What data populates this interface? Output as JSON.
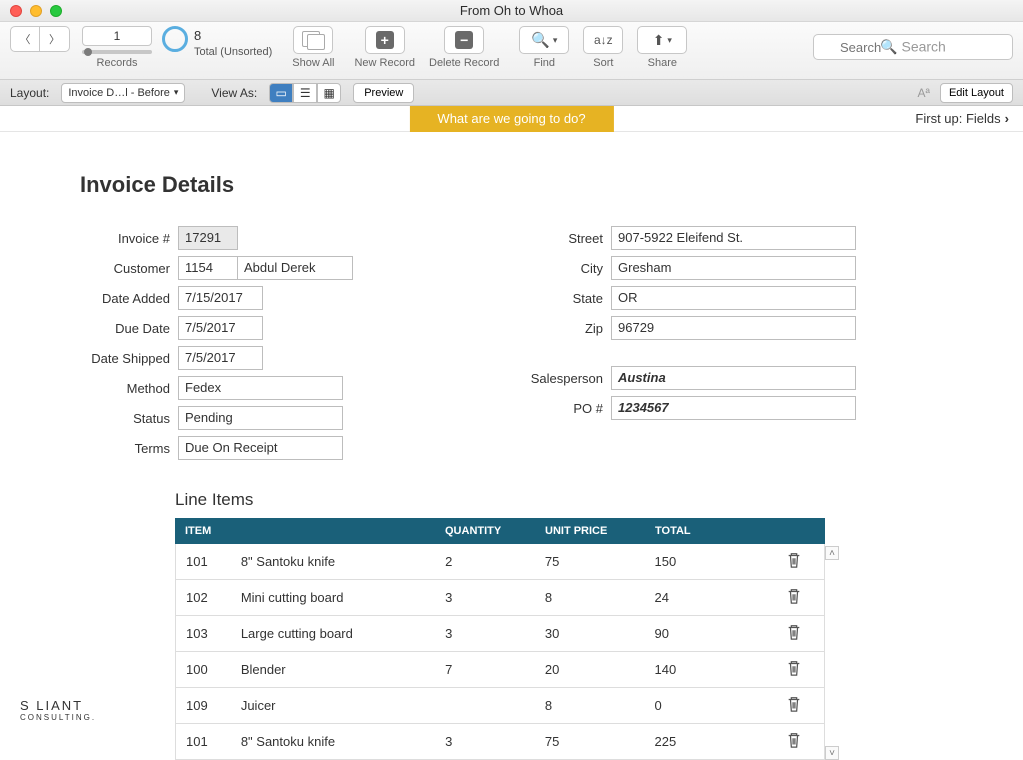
{
  "window": {
    "title": "From Oh to Whoa"
  },
  "toolbar": {
    "record_index": "1",
    "record_total": "8",
    "record_status": "Total (Unsorted)",
    "records_label": "Records",
    "showall_label": "Show All",
    "newrecord_label": "New Record",
    "deleterecord_label": "Delete Record",
    "find_label": "Find",
    "sort_label": "Sort",
    "share_label": "Share",
    "search_placeholder": "Search"
  },
  "statusbar": {
    "layout_label": "Layout:",
    "layout_value": "Invoice D…l - Before",
    "viewas_label": "View As:",
    "preview_label": "Preview",
    "aa_label": "Aª",
    "editlayout_label": "Edit Layout"
  },
  "banner": {
    "center": "What are we going to do?",
    "right": "First up: Fields"
  },
  "page": {
    "title": "Invoice Details",
    "line_items_title": "Line Items"
  },
  "left_fields": {
    "invoice_no_label": "Invoice #",
    "invoice_no": "17291",
    "customer_label": "Customer",
    "customer_id": "1154",
    "customer_name": "Abdul Derek",
    "date_added_label": "Date Added",
    "date_added": "7/15/2017",
    "due_date_label": "Due Date",
    "due_date": "7/5/2017",
    "date_shipped_label": "Date Shipped",
    "date_shipped": "7/5/2017",
    "method_label": "Method",
    "method": "Fedex",
    "status_label": "Status",
    "status": "Pending",
    "terms_label": "Terms",
    "terms": "Due On Receipt"
  },
  "right_fields": {
    "street_label": "Street",
    "street": "907-5922 Eleifend St.",
    "city_label": "City",
    "city": "Gresham",
    "state_label": "State",
    "state": "OR",
    "zip_label": "Zip",
    "zip": "96729",
    "salesperson_label": "Salesperson",
    "salesperson": "Austina",
    "po_label": "PO #",
    "po": "1234567"
  },
  "table": {
    "headers": {
      "item": "ITEM",
      "qty": "QUANTITY",
      "unit": "UNIT PRICE",
      "total": "TOTAL"
    },
    "rows": [
      {
        "id": "101",
        "name": "8\" Santoku knife",
        "qty": "2",
        "unit": "75",
        "total": "150"
      },
      {
        "id": "102",
        "name": "Mini cutting board",
        "qty": "3",
        "unit": "8",
        "total": "24"
      },
      {
        "id": "103",
        "name": "Large cutting board",
        "qty": "3",
        "unit": "30",
        "total": "90"
      },
      {
        "id": "100",
        "name": "Blender",
        "qty": "7",
        "unit": "20",
        "total": "140"
      },
      {
        "id": "109",
        "name": "Juicer",
        "qty": "",
        "unit": "8",
        "total": "0"
      },
      {
        "id": "101",
        "name": "8\" Santoku knife",
        "qty": "3",
        "unit": "75",
        "total": "225"
      }
    ]
  },
  "logo": {
    "brand": "S   LIANT",
    "sub": "CONSULTING."
  }
}
